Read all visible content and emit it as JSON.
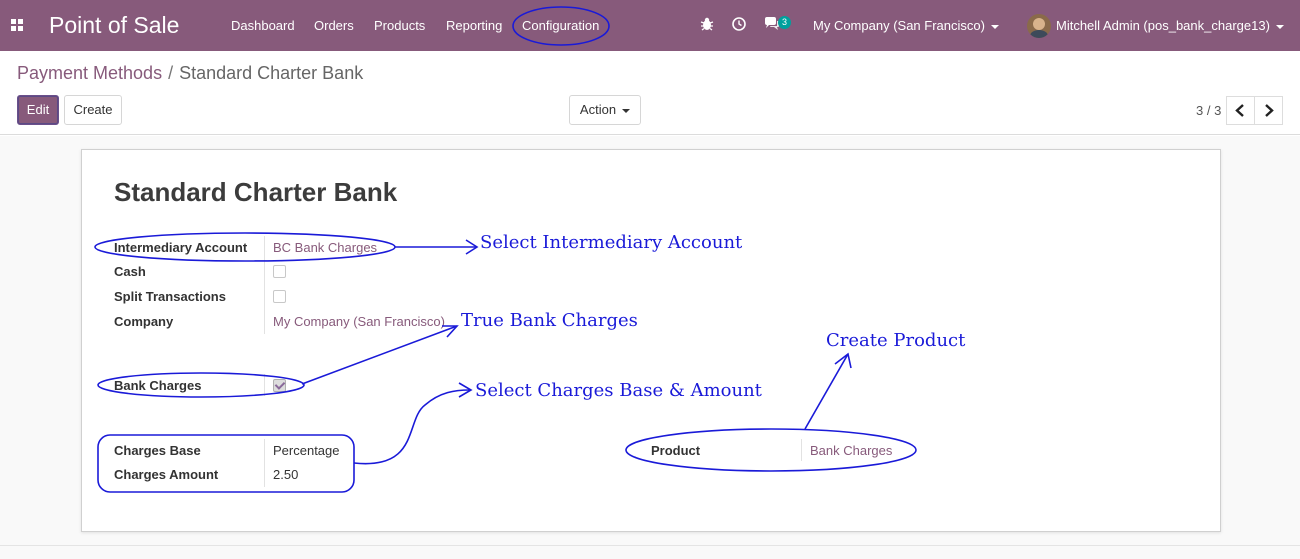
{
  "topbar": {
    "app_title": "Point of Sale",
    "menu": [
      "Dashboard",
      "Orders",
      "Products",
      "Reporting",
      "Configuration"
    ],
    "messages_count": "3",
    "company": "My Company (San Francisco)",
    "user": "Mitchell Admin (pos_bank_charge13)"
  },
  "breadcrumb": {
    "parent": "Payment Methods",
    "separator": "/",
    "current": "Standard Charter Bank"
  },
  "toolbar": {
    "edit_label": "Edit",
    "create_label": "Create",
    "action_label": "Action",
    "pager": "3 / 3"
  },
  "form": {
    "title": "Standard Charter Bank",
    "intermediary_account_label": "Intermediary Account",
    "intermediary_account_value": "BC Bank Charges",
    "cash_label": "Cash",
    "cash_checked": false,
    "split_label": "Split Transactions",
    "split_checked": false,
    "company_label": "Company",
    "company_value": "My Company (San Francisco)",
    "bank_charges_label": "Bank Charges",
    "bank_charges_checked": true,
    "charges_base_label": "Charges Base",
    "charges_base_value": "Percentage",
    "charges_amount_label": "Charges Amount",
    "charges_amount_value": "2.50",
    "product_label": "Product",
    "product_value": "Bank Charges"
  },
  "annotations": {
    "intermediary": "Select Intermediary Account",
    "bank_charges": "True Bank Charges",
    "charges_base": "Select Charges Base & Amount",
    "product": "Create Product"
  },
  "colors": {
    "brand": "#875a7b",
    "annotation": "#1a1ad8",
    "link": "#875a7b"
  }
}
